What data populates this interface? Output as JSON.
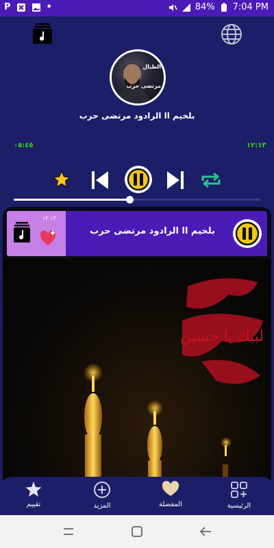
{
  "status_bar": {
    "left_icons": [
      "p-icon",
      "close-box-icon",
      "image-icon"
    ],
    "dot": "•",
    "battery_percent": "84%",
    "time": "7:04 PM"
  },
  "player": {
    "title": "بلخيم اا الرادود مرتضى حرب",
    "elapsed": "٠٥:٤٥",
    "duration": "١٢:١٣",
    "progress": 0.47
  },
  "mini_player": {
    "title": "بلخيم اا الرادود مرتضى حرب",
    "time": "١٢:١٣"
  },
  "avatar_text": {
    "line1": "الطبال",
    "line2": "مرتضى حرب"
  },
  "artwork_text": {
    "calligraphy": "لبيك يا حسين"
  },
  "bottom_nav": {
    "items": [
      {
        "label": "تقييم",
        "icon": "star-icon"
      },
      {
        "label": "المزيد",
        "icon": "plus-circle-icon"
      },
      {
        "label": "المفضلة",
        "icon": "heart-icon"
      },
      {
        "label": "الرئيسية",
        "icon": "grid-plus-icon"
      }
    ]
  },
  "colors": {
    "background": "#1c1e68",
    "status_bar": "#4a1bb5",
    "accent_green": "#33e014",
    "mini_left": "#c780e6",
    "gold": "#f5c518"
  }
}
